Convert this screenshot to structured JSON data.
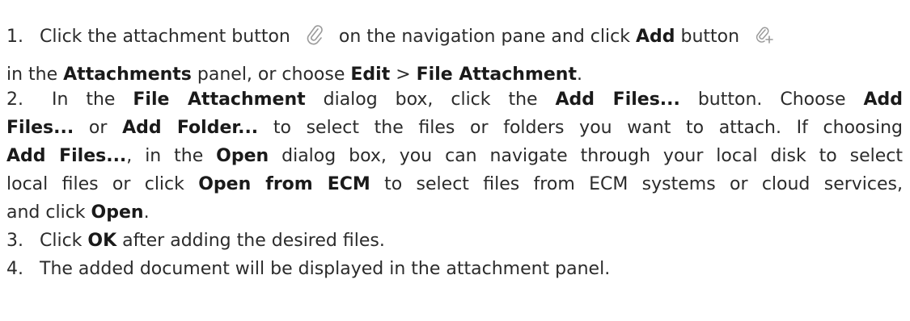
{
  "steps": {
    "s1": {
      "num": "1.",
      "t1": "Click the attachment button",
      "t2": "on the navigation pane and click",
      "b1": "Add",
      "t3": "button",
      "t4": "in the",
      "b2": "Attachments",
      "t5": "panel, or choose",
      "b3": "Edit",
      "t6": ">",
      "b4": "File Attachment",
      "t7": "."
    },
    "s2": {
      "num": "2.",
      "t1": "In the",
      "b1": "File Attachment",
      "t2": "dialog box, click the",
      "b2": "Add Files...",
      "t3": "button. Choose",
      "b3": "Add",
      "b4": "Files...",
      "t4": "or",
      "b5": "Add Folder...",
      "t5": "to select the files or folders you want to attach. If choosing",
      "b6": "Add Files...",
      "t6": ", in the",
      "b7": "Open",
      "t7": "dialog box, you can navigate through your local disk to select",
      "t8": "local files or click",
      "b8": "Open from ECM",
      "t9": "to select files from ECM systems or cloud services,",
      "t10": "and click",
      "b9": "Open",
      "t11": "."
    },
    "s3": {
      "num": "3.",
      "t1": "Click",
      "b1": "OK",
      "t2": "after adding the desired files."
    },
    "s4": {
      "num": "4.",
      "t1": "The added document will be displayed in the attachment panel."
    }
  },
  "icons": {
    "attachment": "paperclip-icon",
    "add": "paperclip-add-icon"
  }
}
